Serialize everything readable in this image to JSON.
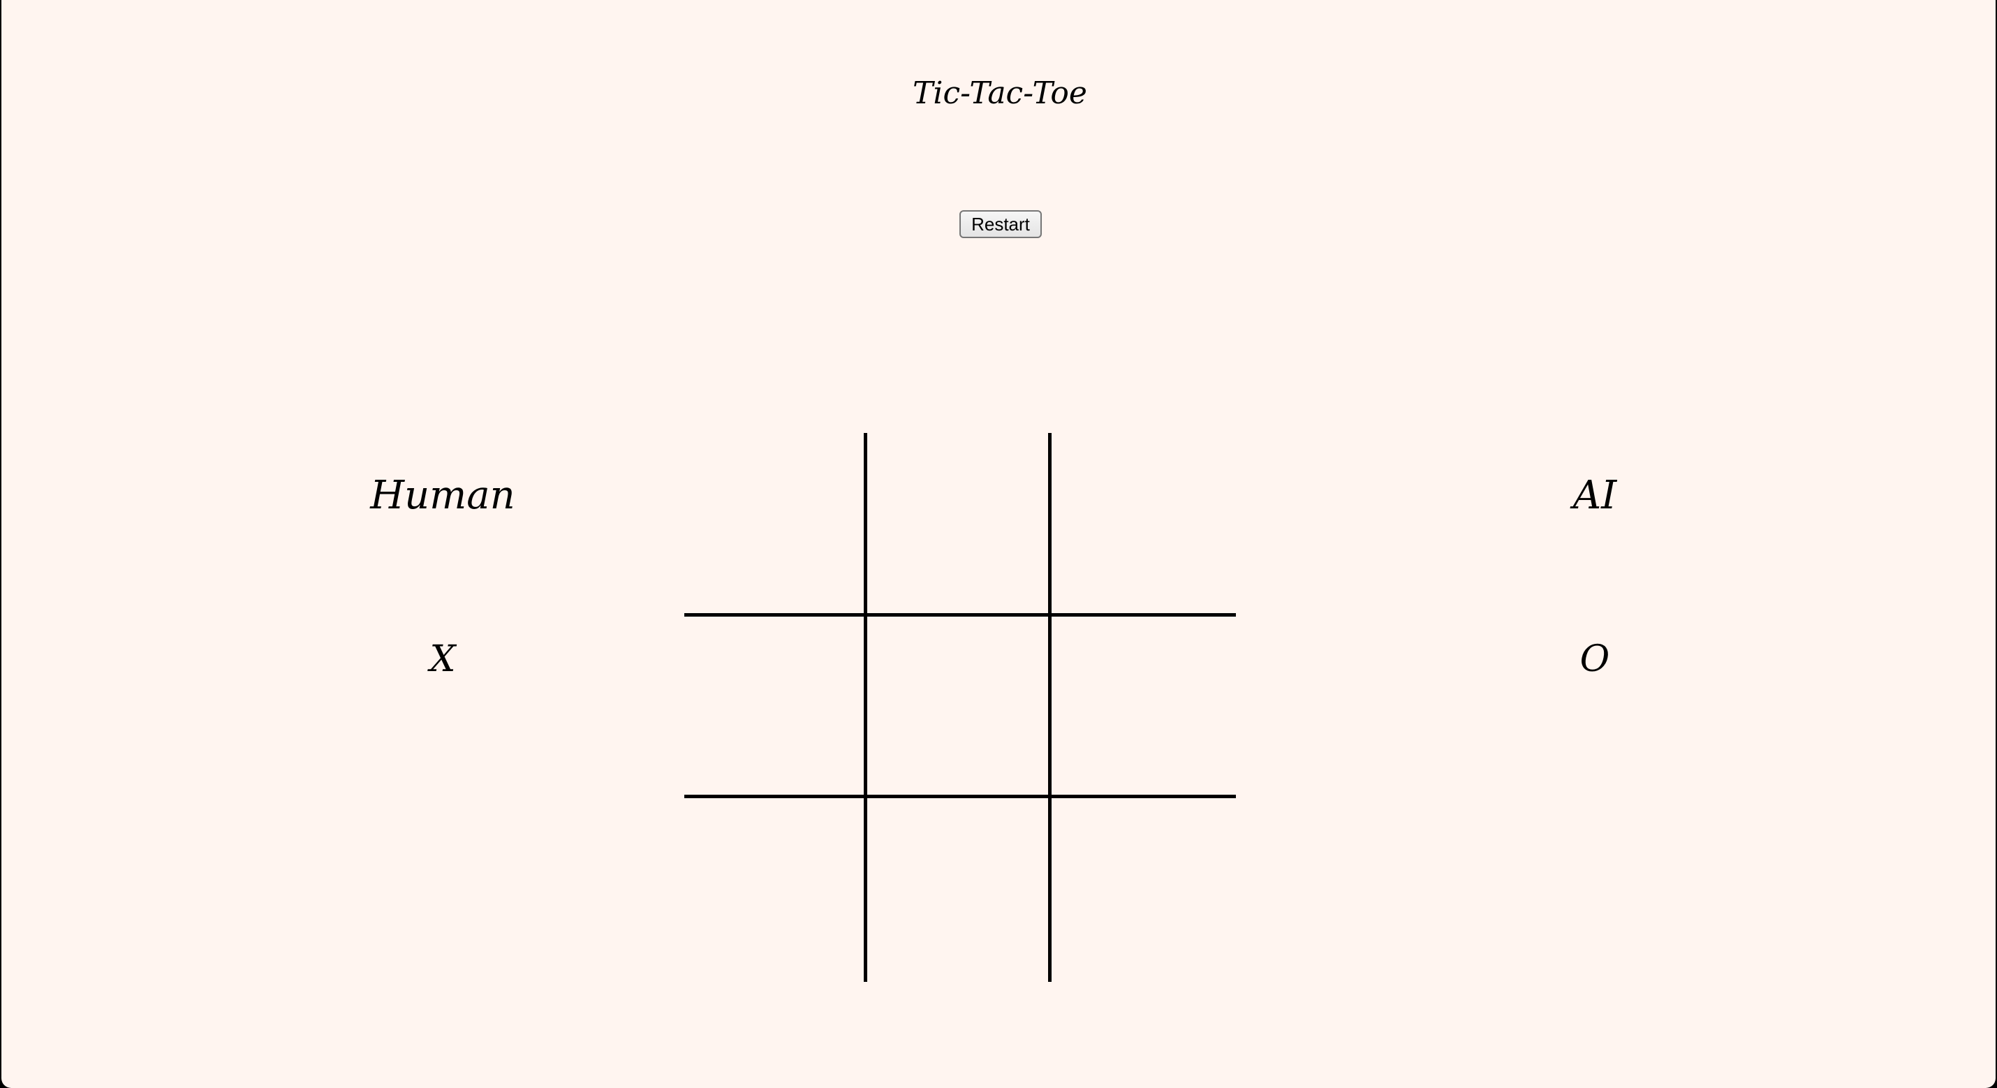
{
  "game": {
    "title": "Tic-Tac-Toe",
    "restart_label": "Restart"
  },
  "players": {
    "human": {
      "name": "Human",
      "mark": "X"
    },
    "ai": {
      "name": "AI",
      "mark": "O"
    }
  },
  "board": {
    "cells": [
      "",
      "",
      "",
      "",
      "",
      "",
      "",
      "",
      ""
    ]
  },
  "colors": {
    "background": "#fff5f0",
    "grid": "#000000"
  }
}
